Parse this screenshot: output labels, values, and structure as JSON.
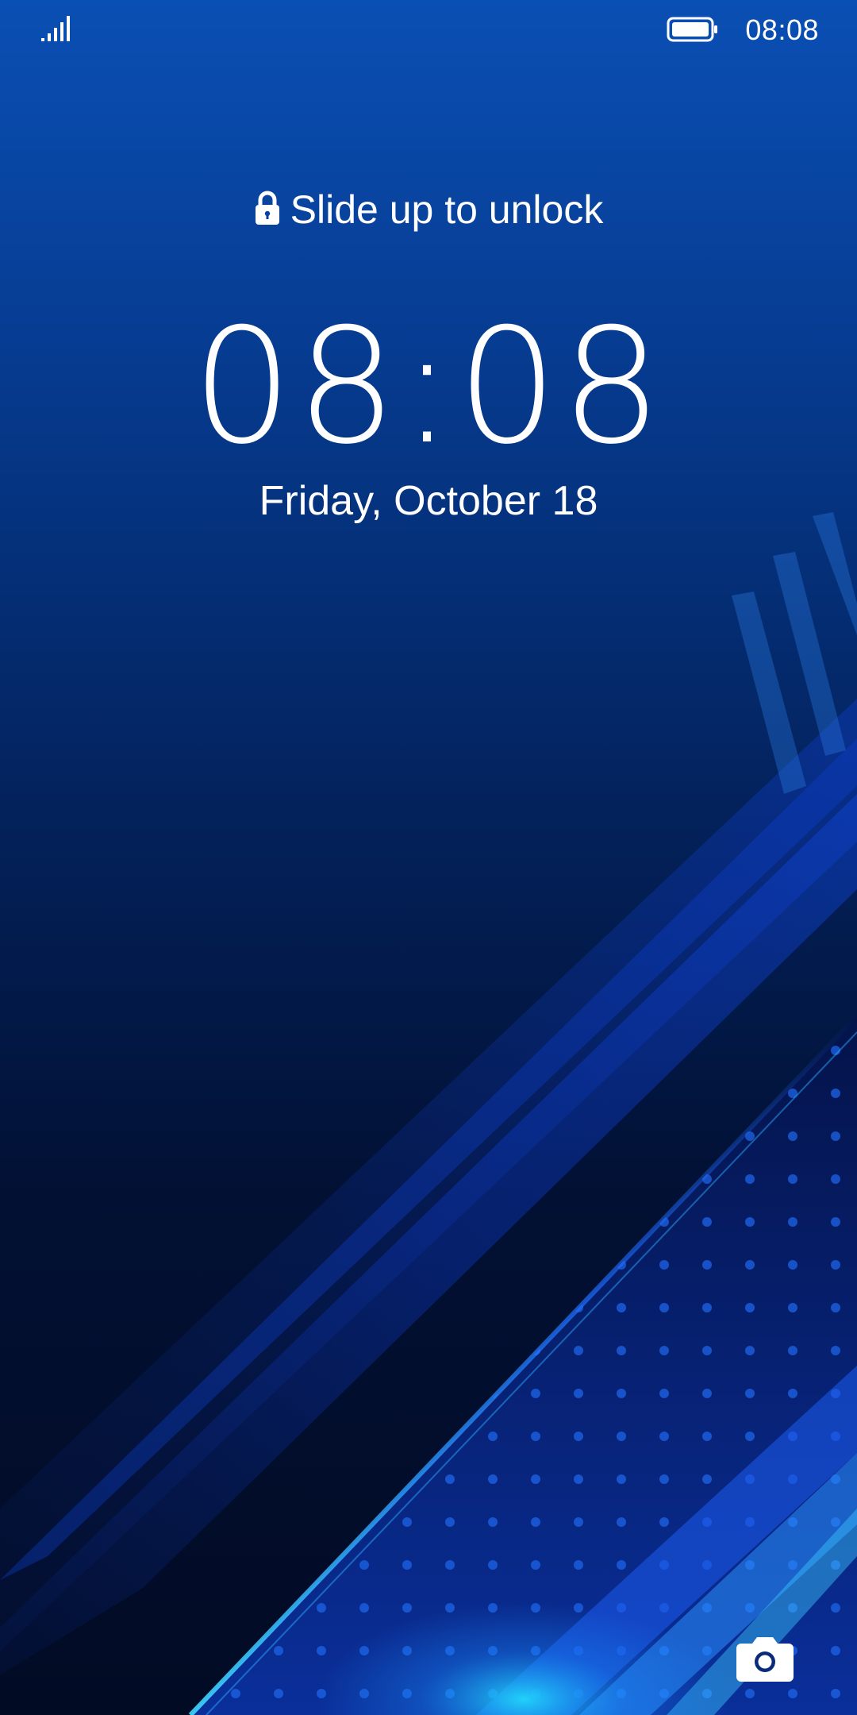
{
  "status_bar": {
    "time": "08:08",
    "signal_icon": "signal-bars-icon",
    "battery_icon": "battery-full-icon"
  },
  "lock_screen": {
    "unlock_hint": "Slide up to unlock",
    "lock_icon": "lock-icon",
    "clock": "08:08",
    "date": "Friday, October 18",
    "camera_icon": "camera-icon"
  },
  "colors": {
    "text": "#ffffff",
    "wallpaper_top": "#0a4fb4",
    "wallpaper_bottom": "#020b24",
    "accent_glow": "#1ec8ff"
  }
}
